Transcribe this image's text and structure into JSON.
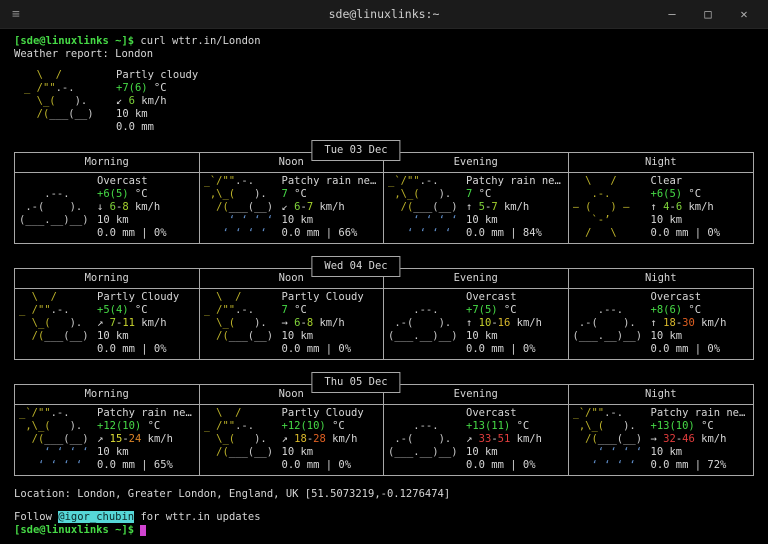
{
  "window": {
    "title": "sde@linuxlinks:~",
    "menu_glyph": "≡",
    "minimize_glyph": "–",
    "maximize_glyph": "□",
    "close_glyph": "✕"
  },
  "colors": {
    "fg": "#d6d6d6",
    "green": "#46da46",
    "sun": "#bdb32a",
    "cloud": "#c9c9c9",
    "rain": "#5e8cc7",
    "border": "#a8a8a8",
    "cyanBg": "#56d7d7",
    "cyanText": "#0d2b2b",
    "cursor": "#d044d0",
    "titlebarBg": "#1b1b1b",
    "titleFg": "#cfcfcf",
    "w118": "#7fd33a",
    "w154": "#a4d02c",
    "w190": "#c8d32e",
    "w226": "#dede35",
    "w220": "#d9b92c",
    "w208": "#dd8526",
    "w202": "#e06022",
    "w196": "#e23d3d"
  },
  "shell": {
    "prompt": "[sde@linuxlinks ~]$",
    "command": " curl wttr.in/London",
    "report_title": "Weather report: London"
  },
  "arts": {
    "partlyCloudy": [
      [
        {
          "t": "  \\  /",
          "c": "sun"
        }
      ],
      [
        {
          "t": "_ /\"\"",
          "c": "sun"
        },
        {
          "t": ".-.",
          "c": "cloud"
        }
      ],
      [
        {
          "t": "  \\_(",
          "c": "sun"
        },
        {
          "t": "   ).",
          "c": "cloud"
        }
      ],
      [
        {
          "t": "  /(",
          "c": "sun"
        },
        {
          "t": "___(__)",
          "c": "cloud"
        }
      ]
    ],
    "overcast": [
      [
        {
          "t": "",
          "c": "cloud"
        }
      ],
      [
        {
          "t": "    .--.",
          "c": "cloud"
        }
      ],
      [
        {
          "t": " .-(    ).",
          "c": "cloud"
        }
      ],
      [
        {
          "t": "(___.__)__)",
          "c": "cloud"
        }
      ]
    ],
    "patchyRain": [
      [
        {
          "t": "_`/\"\"",
          "c": "sun"
        },
        {
          "t": ".-.",
          "c": "cloud"
        }
      ],
      [
        {
          "t": " ,\\_(",
          "c": "sun"
        },
        {
          "t": "   ).",
          "c": "cloud"
        }
      ],
      [
        {
          "t": "  /(",
          "c": "sun"
        },
        {
          "t": "___(__)",
          "c": "cloud"
        }
      ],
      [
        {
          "t": "    ‘ ‘ ‘ ‘",
          "c": "rain"
        }
      ],
      [
        {
          "t": "   ‘ ‘ ‘ ‘",
          "c": "rain"
        }
      ]
    ],
    "clearNight": [
      [
        {
          "t": "  \\   /",
          "c": "sun"
        }
      ],
      [
        {
          "t": "   .-.",
          "c": "sun"
        }
      ],
      [
        {
          "t": "― (   ) ―",
          "c": "sun"
        }
      ],
      [
        {
          "t": "   `-’",
          "c": "sun"
        }
      ],
      [
        {
          "t": "  /   \\",
          "c": "sun"
        }
      ]
    ]
  },
  "current": {
    "art": "partlyCloudy",
    "condition": "Partly cloudy",
    "temp": "+7(6)",
    "temp_unit": " °C",
    "wind": {
      "arrow": "↙ ",
      "parts": [
        {
          "t": "6",
          "c": "w118"
        }
      ],
      "unit": " km/h"
    },
    "visibility": "10 km",
    "precip": "0.0 mm"
  },
  "forecast_tables": [
    {
      "date": "Tue 03 Dec",
      "columns": [
        "Morning",
        "Noon",
        "Evening",
        "Night"
      ],
      "cells": [
        {
          "art": "overcast",
          "condition": "Overcast",
          "temp": "+6(5)",
          "wind": {
            "arrow": "↓ ",
            "parts": [
              {
                "t": "6",
                "c": "w118"
              },
              {
                "t": "-",
                "c": "fg"
              },
              {
                "t": "8",
                "c": "w154"
              }
            ],
            "unit": " km/h"
          },
          "visibility": "10 km",
          "precip": "0.0 mm | 0%"
        },
        {
          "art": "patchyRain",
          "condition": "Patchy rain ne…",
          "temp": "7",
          "wind": {
            "arrow": "↙ ",
            "parts": [
              {
                "t": "6",
                "c": "w118"
              },
              {
                "t": "-",
                "c": "fg"
              },
              {
                "t": "7",
                "c": "w154"
              }
            ],
            "unit": " km/h"
          },
          "visibility": "10 km",
          "precip": "0.0 mm | 66%"
        },
        {
          "art": "patchyRain",
          "condition": "Patchy rain ne…",
          "temp": "7",
          "wind": {
            "arrow": "↑ ",
            "parts": [
              {
                "t": "5",
                "c": "w118"
              },
              {
                "t": "-",
                "c": "fg"
              },
              {
                "t": "7",
                "c": "w154"
              }
            ],
            "unit": " km/h"
          },
          "visibility": "10 km",
          "precip": "0.0 mm | 84%"
        },
        {
          "art": "clearNight",
          "condition": "Clear",
          "temp": "+6(5)",
          "wind": {
            "arrow": "↑ ",
            "parts": [
              {
                "t": "4",
                "c": "w118"
              },
              {
                "t": "-",
                "c": "fg"
              },
              {
                "t": "6",
                "c": "w118"
              }
            ],
            "unit": " km/h"
          },
          "visibility": "10 km",
          "precip": "0.0 mm | 0%"
        }
      ]
    },
    {
      "date": "Wed 04 Dec",
      "columns": [
        "Morning",
        "Noon",
        "Evening",
        "Night"
      ],
      "cells": [
        {
          "art": "partlyCloudy",
          "condition": "Partly Cloudy",
          "temp": "+5(4)",
          "wind": {
            "arrow": "↗ ",
            "parts": [
              {
                "t": "7",
                "c": "w154"
              },
              {
                "t": "-",
                "c": "fg"
              },
              {
                "t": "11",
                "c": "w190"
              }
            ],
            "unit": " km/h"
          },
          "visibility": "10 km",
          "precip": "0.0 mm | 0%"
        },
        {
          "art": "partlyCloudy",
          "condition": "Partly Cloudy",
          "temp": "7",
          "wind": {
            "arrow": "→ ",
            "parts": [
              {
                "t": "6",
                "c": "w118"
              },
              {
                "t": "-",
                "c": "fg"
              },
              {
                "t": "8",
                "c": "w154"
              }
            ],
            "unit": " km/h"
          },
          "visibility": "10 km",
          "precip": "0.0 mm | 0%"
        },
        {
          "art": "overcast",
          "condition": "Overcast",
          "temp": "+7(5)",
          "wind": {
            "arrow": "↑ ",
            "parts": [
              {
                "t": "10",
                "c": "w190"
              },
              {
                "t": "-",
                "c": "fg"
              },
              {
                "t": "16",
                "c": "w220"
              }
            ],
            "unit": " km/h"
          },
          "visibility": "10 km",
          "precip": "0.0 mm | 0%"
        },
        {
          "art": "overcast",
          "condition": "Overcast",
          "temp": "+8(6)",
          "wind": {
            "arrow": "↑ ",
            "parts": [
              {
                "t": "18",
                "c": "w220"
              },
              {
                "t": "-",
                "c": "fg"
              },
              {
                "t": "30",
                "c": "w202"
              }
            ],
            "unit": " km/h"
          },
          "visibility": "10 km",
          "precip": "0.0 mm | 0%"
        }
      ]
    },
    {
      "date": "Thu 05 Dec",
      "columns": [
        "Morning",
        "Noon",
        "Evening",
        "Night"
      ],
      "cells": [
        {
          "art": "patchyRain",
          "condition": "Patchy rain ne…",
          "temp": "+12(10)",
          "wind": {
            "arrow": "↗ ",
            "parts": [
              {
                "t": "15",
                "c": "w226"
              },
              {
                "t": "-",
                "c": "fg"
              },
              {
                "t": "24",
                "c": "w208"
              }
            ],
            "unit": " km/h"
          },
          "visibility": "10 km",
          "precip": "0.0 mm | 65%"
        },
        {
          "art": "partlyCloudy",
          "condition": "Partly Cloudy",
          "temp": "+12(10)",
          "wind": {
            "arrow": "↗ ",
            "parts": [
              {
                "t": "18",
                "c": "w220"
              },
              {
                "t": "-",
                "c": "fg"
              },
              {
                "t": "28",
                "c": "w202"
              }
            ],
            "unit": " km/h"
          },
          "visibility": "10 km",
          "precip": "0.0 mm | 0%"
        },
        {
          "art": "overcast",
          "condition": "Overcast",
          "temp": "+13(11)",
          "wind": {
            "arrow": "↗ ",
            "parts": [
              {
                "t": "33",
                "c": "w196"
              },
              {
                "t": "-",
                "c": "fg"
              },
              {
                "t": "51",
                "c": "w196"
              }
            ],
            "unit": " km/h"
          },
          "visibility": "10 km",
          "precip": "0.0 mm | 0%"
        },
        {
          "art": "patchyRain",
          "condition": "Patchy rain ne…",
          "temp": "+13(10)",
          "wind": {
            "arrow": "→ ",
            "parts": [
              {
                "t": "32",
                "c": "w196"
              },
              {
                "t": "-",
                "c": "fg"
              },
              {
                "t": "46",
                "c": "w196"
              }
            ],
            "unit": " km/h"
          },
          "visibility": "10 km",
          "precip": "0.0 mm | 72%"
        }
      ]
    }
  ],
  "footer": {
    "location": "Location: London, Greater London, England, UK [51.5073219,-0.1276474]",
    "follow_prefix": "Follow ",
    "follow_handle": "@igor_chubin",
    "follow_suffix": " for wttr.in updates",
    "prompt": "[sde@linuxlinks ~]$"
  }
}
